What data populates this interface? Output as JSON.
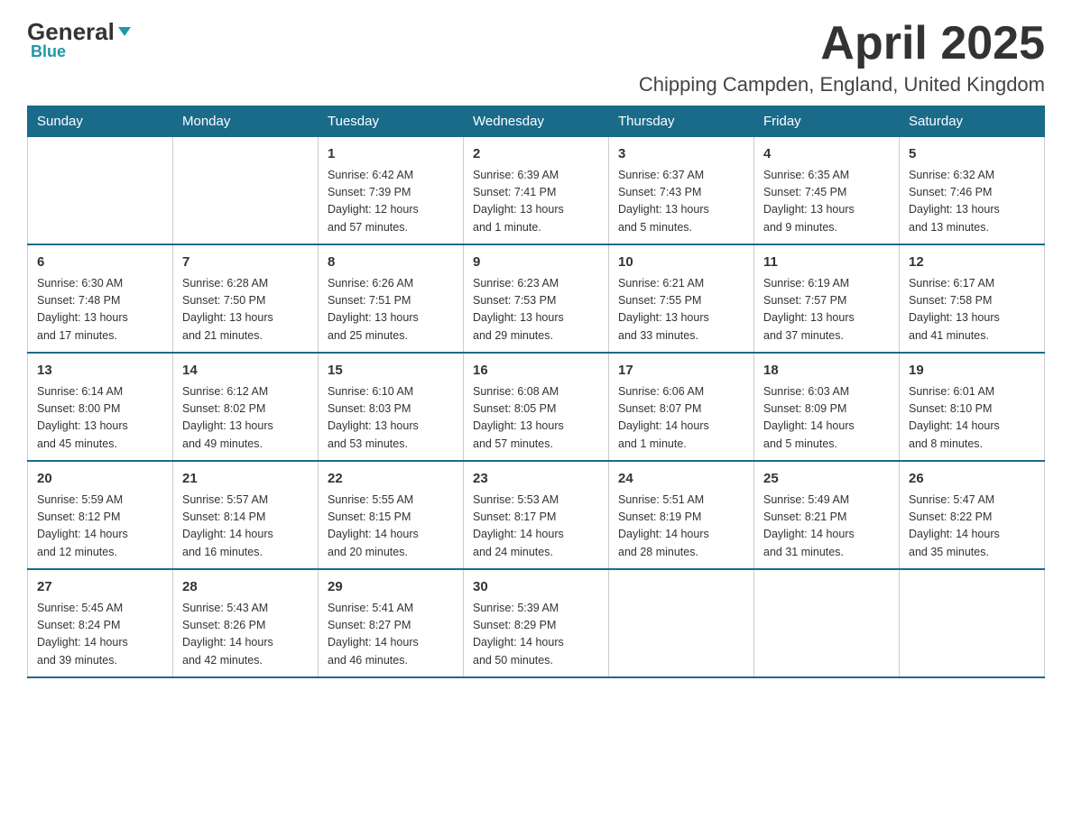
{
  "header": {
    "logo_general": "General",
    "logo_blue": "Blue",
    "title": "April 2025",
    "subtitle": "Chipping Campden, England, United Kingdom"
  },
  "weekdays": [
    "Sunday",
    "Monday",
    "Tuesday",
    "Wednesday",
    "Thursday",
    "Friday",
    "Saturday"
  ],
  "weeks": [
    [
      {
        "day": "",
        "info": ""
      },
      {
        "day": "",
        "info": ""
      },
      {
        "day": "1",
        "info": "Sunrise: 6:42 AM\nSunset: 7:39 PM\nDaylight: 12 hours\nand 57 minutes."
      },
      {
        "day": "2",
        "info": "Sunrise: 6:39 AM\nSunset: 7:41 PM\nDaylight: 13 hours\nand 1 minute."
      },
      {
        "day": "3",
        "info": "Sunrise: 6:37 AM\nSunset: 7:43 PM\nDaylight: 13 hours\nand 5 minutes."
      },
      {
        "day": "4",
        "info": "Sunrise: 6:35 AM\nSunset: 7:45 PM\nDaylight: 13 hours\nand 9 minutes."
      },
      {
        "day": "5",
        "info": "Sunrise: 6:32 AM\nSunset: 7:46 PM\nDaylight: 13 hours\nand 13 minutes."
      }
    ],
    [
      {
        "day": "6",
        "info": "Sunrise: 6:30 AM\nSunset: 7:48 PM\nDaylight: 13 hours\nand 17 minutes."
      },
      {
        "day": "7",
        "info": "Sunrise: 6:28 AM\nSunset: 7:50 PM\nDaylight: 13 hours\nand 21 minutes."
      },
      {
        "day": "8",
        "info": "Sunrise: 6:26 AM\nSunset: 7:51 PM\nDaylight: 13 hours\nand 25 minutes."
      },
      {
        "day": "9",
        "info": "Sunrise: 6:23 AM\nSunset: 7:53 PM\nDaylight: 13 hours\nand 29 minutes."
      },
      {
        "day": "10",
        "info": "Sunrise: 6:21 AM\nSunset: 7:55 PM\nDaylight: 13 hours\nand 33 minutes."
      },
      {
        "day": "11",
        "info": "Sunrise: 6:19 AM\nSunset: 7:57 PM\nDaylight: 13 hours\nand 37 minutes."
      },
      {
        "day": "12",
        "info": "Sunrise: 6:17 AM\nSunset: 7:58 PM\nDaylight: 13 hours\nand 41 minutes."
      }
    ],
    [
      {
        "day": "13",
        "info": "Sunrise: 6:14 AM\nSunset: 8:00 PM\nDaylight: 13 hours\nand 45 minutes."
      },
      {
        "day": "14",
        "info": "Sunrise: 6:12 AM\nSunset: 8:02 PM\nDaylight: 13 hours\nand 49 minutes."
      },
      {
        "day": "15",
        "info": "Sunrise: 6:10 AM\nSunset: 8:03 PM\nDaylight: 13 hours\nand 53 minutes."
      },
      {
        "day": "16",
        "info": "Sunrise: 6:08 AM\nSunset: 8:05 PM\nDaylight: 13 hours\nand 57 minutes."
      },
      {
        "day": "17",
        "info": "Sunrise: 6:06 AM\nSunset: 8:07 PM\nDaylight: 14 hours\nand 1 minute."
      },
      {
        "day": "18",
        "info": "Sunrise: 6:03 AM\nSunset: 8:09 PM\nDaylight: 14 hours\nand 5 minutes."
      },
      {
        "day": "19",
        "info": "Sunrise: 6:01 AM\nSunset: 8:10 PM\nDaylight: 14 hours\nand 8 minutes."
      }
    ],
    [
      {
        "day": "20",
        "info": "Sunrise: 5:59 AM\nSunset: 8:12 PM\nDaylight: 14 hours\nand 12 minutes."
      },
      {
        "day": "21",
        "info": "Sunrise: 5:57 AM\nSunset: 8:14 PM\nDaylight: 14 hours\nand 16 minutes."
      },
      {
        "day": "22",
        "info": "Sunrise: 5:55 AM\nSunset: 8:15 PM\nDaylight: 14 hours\nand 20 minutes."
      },
      {
        "day": "23",
        "info": "Sunrise: 5:53 AM\nSunset: 8:17 PM\nDaylight: 14 hours\nand 24 minutes."
      },
      {
        "day": "24",
        "info": "Sunrise: 5:51 AM\nSunset: 8:19 PM\nDaylight: 14 hours\nand 28 minutes."
      },
      {
        "day": "25",
        "info": "Sunrise: 5:49 AM\nSunset: 8:21 PM\nDaylight: 14 hours\nand 31 minutes."
      },
      {
        "day": "26",
        "info": "Sunrise: 5:47 AM\nSunset: 8:22 PM\nDaylight: 14 hours\nand 35 minutes."
      }
    ],
    [
      {
        "day": "27",
        "info": "Sunrise: 5:45 AM\nSunset: 8:24 PM\nDaylight: 14 hours\nand 39 minutes."
      },
      {
        "day": "28",
        "info": "Sunrise: 5:43 AM\nSunset: 8:26 PM\nDaylight: 14 hours\nand 42 minutes."
      },
      {
        "day": "29",
        "info": "Sunrise: 5:41 AM\nSunset: 8:27 PM\nDaylight: 14 hours\nand 46 minutes."
      },
      {
        "day": "30",
        "info": "Sunrise: 5:39 AM\nSunset: 8:29 PM\nDaylight: 14 hours\nand 50 minutes."
      },
      {
        "day": "",
        "info": ""
      },
      {
        "day": "",
        "info": ""
      },
      {
        "day": "",
        "info": ""
      }
    ]
  ]
}
